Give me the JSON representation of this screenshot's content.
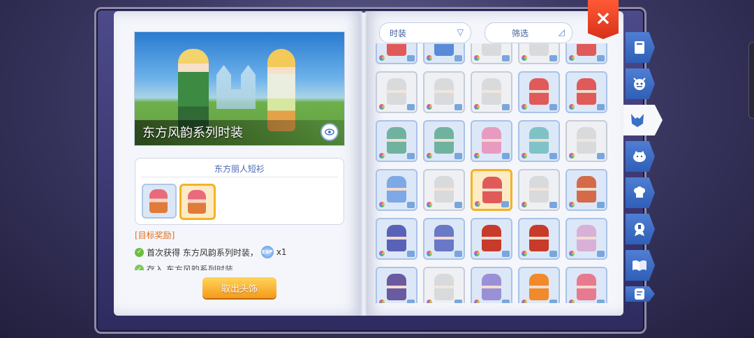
{
  "left": {
    "banner_title": "东方风韵系列时装",
    "set_name": "东方丽人短衫",
    "goal_title": "[目标奖励]",
    "goals": [
      {
        "text": "首次获得 东方风韵系列时装，",
        "reward": "x1",
        "reward_icon": "EXP"
      },
      {
        "text": "存入 东方风韵系列时装"
      }
    ],
    "take_off_button": "取出头饰"
  },
  "right": {
    "type_dropdown": "时装",
    "filter_dropdown": "筛选",
    "grid_colors": [
      [
        "#e05a5a",
        "#5a8ad8",
        "#c8c8c8",
        "#c8c8c8",
        "#e05a5a"
      ],
      [
        "#c8c8c8",
        "#c8c8c8",
        "#c8c8c8",
        "#e05a5a",
        "#e05a5a"
      ],
      [
        "#6fb2a0",
        "#6fb2a0",
        "#e89ac0",
        "#7fc2c8",
        "#c8c8c8"
      ],
      [
        "#7ea8e6",
        "#c8c8c8",
        "#e05a5a",
        "#c8c8c8",
        "#d46a4a"
      ],
      [
        "#5a62b8",
        "#6a78c8",
        "#c83a2a",
        "#c83a2a",
        "#d8b0d8"
      ],
      [
        "#6a5aa0",
        "#c8c8c8",
        "#9a90d8",
        "#f08a2a",
        "#e87a90"
      ]
    ],
    "grid_gray": [
      [
        false,
        false,
        true,
        true,
        false
      ],
      [
        true,
        true,
        true,
        false,
        false
      ],
      [
        false,
        false,
        false,
        false,
        true
      ],
      [
        false,
        true,
        false,
        true,
        false
      ],
      [
        false,
        false,
        false,
        false,
        false
      ],
      [
        false,
        true,
        false,
        false,
        false
      ]
    ],
    "selected_cell": [
      3,
      2
    ]
  },
  "tabs": [
    "book-icon",
    "demon-face-icon",
    "cat-ears-icon",
    "cat-face-icon",
    "chef-hat-icon",
    "badge-icon",
    "open-book-icon",
    "scroll-icon"
  ],
  "active_tab": 2,
  "close_button": "×"
}
